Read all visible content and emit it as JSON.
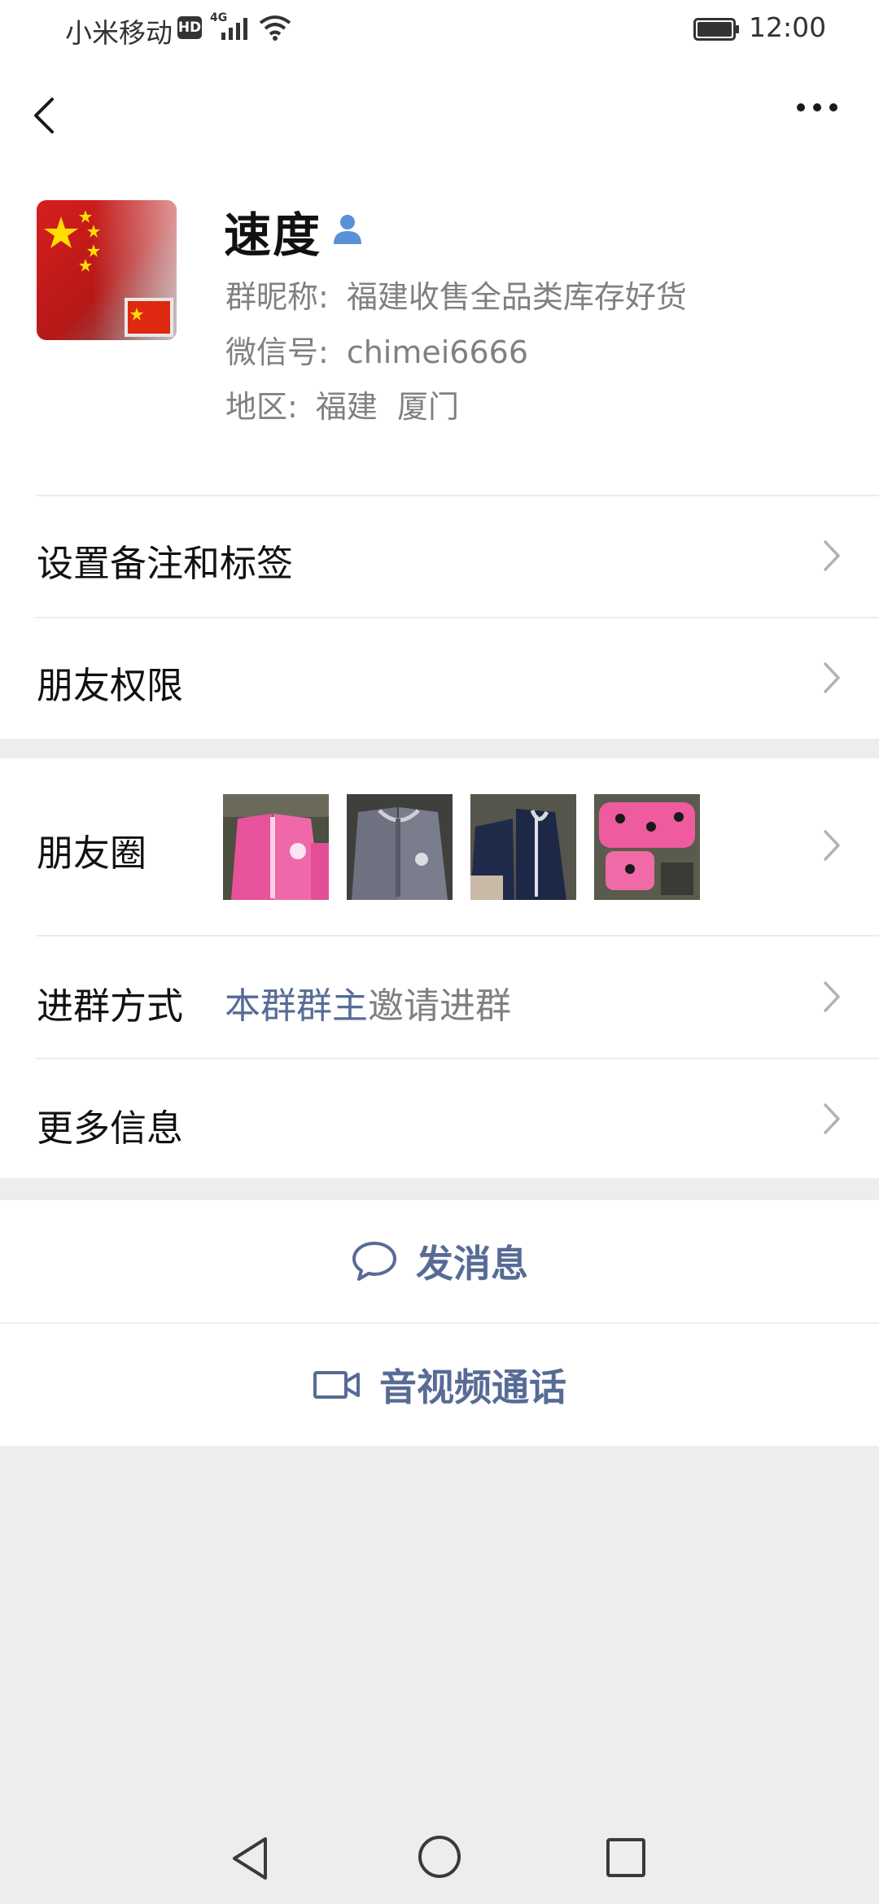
{
  "status_bar": {
    "carrier": "小米移动",
    "hd": "HD",
    "network": "4G",
    "time": "12:00"
  },
  "nav": {
    "back_icon": "back-chevron-icon",
    "more_icon": "more-dots-icon"
  },
  "profile": {
    "name": "速度",
    "nickname_label": "群昵称:",
    "nickname_value": "福建收售全品类库存好货",
    "wechat_id_label": "微信号:",
    "wechat_id_value": "chimei6666",
    "region_label": "地区:",
    "region_value": "福建  厦门"
  },
  "cells": {
    "remark_tags": "设置备注和标签",
    "friend_permissions": "朋友权限",
    "moments": "朋友圈",
    "join_method_label": "进群方式",
    "join_method_link": "本群群主",
    "join_method_rest": "邀请进群",
    "more_info": "更多信息"
  },
  "actions": {
    "send_message": "发消息",
    "video_call": "音视频通话"
  },
  "colors": {
    "link": "#576b95",
    "background": "#ededed",
    "card": "#ffffff"
  }
}
